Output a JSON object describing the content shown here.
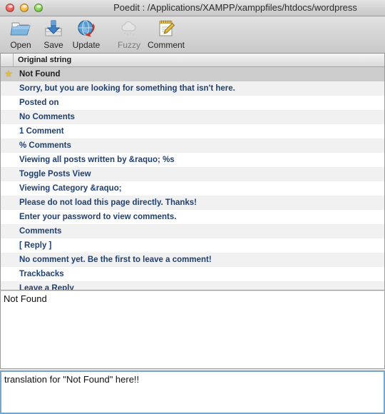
{
  "window": {
    "title": "Poedit : /Applications/XAMPP/xamppfiles/htdocs/wordpress",
    "controls": {
      "close": "close-button",
      "minimize": "minimize-button",
      "zoom": "zoom-button"
    }
  },
  "toolbar": {
    "buttons": [
      {
        "label": "Open",
        "icon": "open-folder-icon",
        "enabled": true
      },
      {
        "label": "Save",
        "icon": "save-disk-icon",
        "enabled": true
      },
      {
        "label": "Update",
        "icon": "update-globe-icon",
        "enabled": true
      },
      {
        "label": "Fuzzy",
        "icon": "fuzzy-cloud-icon",
        "enabled": false
      },
      {
        "label": "Comment",
        "icon": "comment-notepad-icon",
        "enabled": true
      }
    ]
  },
  "list": {
    "columns": [
      "",
      "Original string"
    ],
    "rows": [
      {
        "text": "Not Found",
        "starred": true,
        "selected": true
      },
      {
        "text": "Sorry, but you are looking for something that isn't here.",
        "starred": false,
        "selected": false
      },
      {
        "text": "Posted on",
        "starred": false,
        "selected": false
      },
      {
        "text": "No Comments",
        "starred": false,
        "selected": false
      },
      {
        "text": "1 Comment",
        "starred": false,
        "selected": false
      },
      {
        "text": "% Comments",
        "starred": false,
        "selected": false
      },
      {
        "text": "Viewing all posts written by &raquo; %s",
        "starred": false,
        "selected": false
      },
      {
        "text": "Toggle Posts View",
        "starred": false,
        "selected": false
      },
      {
        "text": "Viewing Category &raquo;",
        "starred": false,
        "selected": false
      },
      {
        "text": "Please do not load this page directly. Thanks!",
        "starred": false,
        "selected": false
      },
      {
        "text": "Enter your password to view comments.",
        "starred": false,
        "selected": false
      },
      {
        "text": "Comments",
        "starred": false,
        "selected": false
      },
      {
        "text": "[ Reply ]",
        "starred": false,
        "selected": false
      },
      {
        "text": "No comment yet. Be the first to leave a comment!",
        "starred": false,
        "selected": false
      },
      {
        "text": "Trackbacks",
        "starred": false,
        "selected": false
      },
      {
        "text": "Leave a Reply",
        "starred": false,
        "selected": false
      }
    ]
  },
  "source_panel": {
    "value": "Not Found"
  },
  "translation_panel": {
    "value": "translation for \"Not Found\" here!!"
  },
  "colors": {
    "row_text": "#204070",
    "selected_row_bg": "#cccccc",
    "alt_row_bg": "#f1f1f1",
    "focus_border": "#77a6cd",
    "star": "#e8b93c"
  }
}
